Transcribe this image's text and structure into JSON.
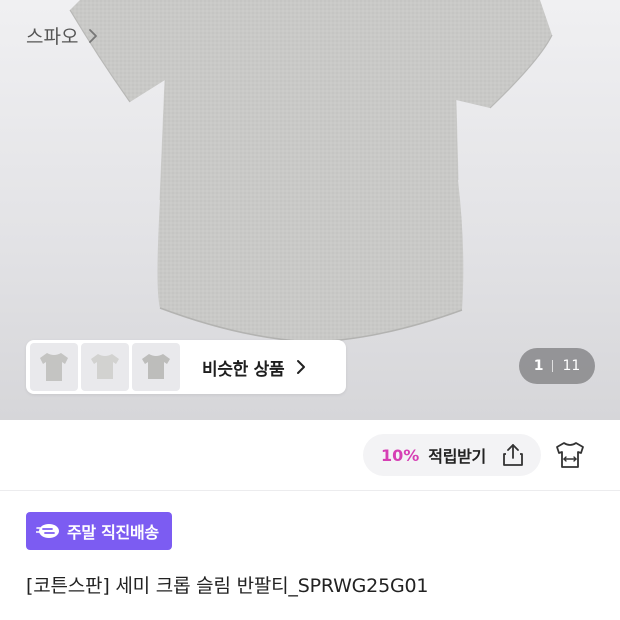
{
  "hero": {
    "pager": {
      "current": "1",
      "total": "11"
    }
  },
  "similar": {
    "label": "비슷한 상품",
    "thumbnails": [
      "thumb-tshirt-1",
      "thumb-tshirt-2",
      "thumb-tshirt-3"
    ]
  },
  "brand": {
    "name": "스파오"
  },
  "reward": {
    "percent": "10%",
    "label": "적립받기"
  },
  "badge": {
    "label": "주말 직진배송",
    "color": "#7c5cf2"
  },
  "product": {
    "title": "[코튼스판] 세미 크롭 슬림 반팔티_SPRWG25G01"
  },
  "colors": {
    "accent_pink": "#d63fb4",
    "accent_purple": "#7c5cf2"
  }
}
